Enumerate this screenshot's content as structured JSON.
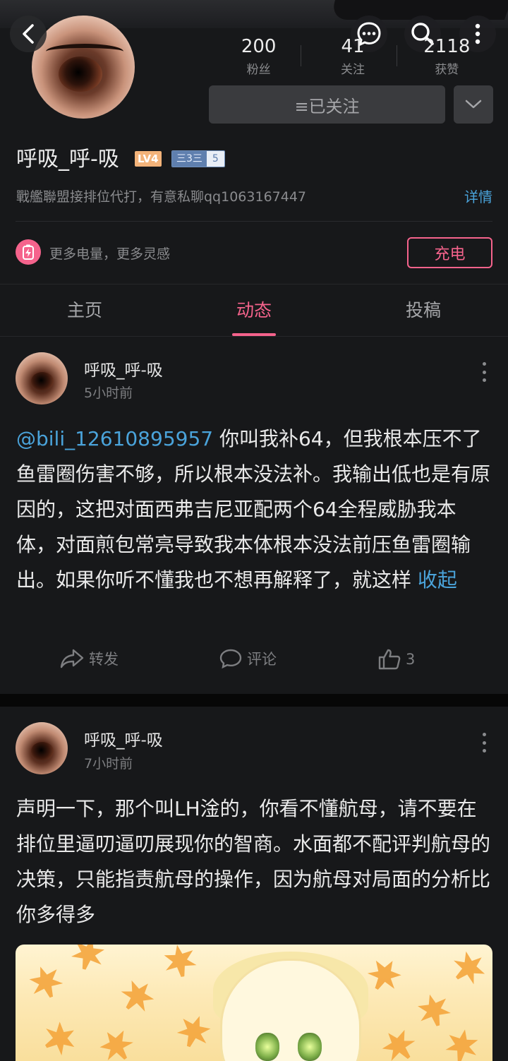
{
  "profile": {
    "stats": [
      {
        "value": "200",
        "label": "粉丝"
      },
      {
        "value": "41",
        "label": "关注"
      },
      {
        "value": "2118",
        "label": "获赞"
      }
    ],
    "follow_label": "≡已关注",
    "username": "呼吸_呼-吸",
    "level_badge": "LV4",
    "medal_name": "三3三",
    "medal_level": "5",
    "bio": "戰艦聯盟接排位代打，有意私聊qq1063167447",
    "detail_link": "详情",
    "charge_text": "更多电量，更多灵感",
    "charge_button": "充电"
  },
  "tabs": [
    {
      "label": "主页",
      "active": false
    },
    {
      "label": "动态",
      "active": true
    },
    {
      "label": "投稿",
      "active": false
    }
  ],
  "posts": [
    {
      "author": "呼吸_呼-吸",
      "time": "5小时前",
      "mention": "@bili_12610895957",
      "text": " 你叫我补64，但我根本压不了鱼雷圈伤害不够，所以根本没法补。我输出低也是有原因的，这把对面西弗吉尼亚配两个64全程威胁我本体，对面煎包常亮导致我本体根本没法前压鱼雷圈输出。如果你听不懂我也不想再解释了，就这样 ",
      "collapse": "收起",
      "repost_label": "转发",
      "comment_label": "评论",
      "like_count": "3"
    },
    {
      "author": "呼吸_呼-吸",
      "time": "7小时前",
      "text": "声明一下，那个叫LH淦的，你看不懂航母，请不要在排位里逼叨逼叨展现你的智商。水面都不配评判航母的决策，只能指责航母的操作，因为航母对局面的分析比你多得多"
    }
  ],
  "colors": {
    "accent_pink": "#f5638c",
    "link_blue": "#4aa3da",
    "background": "#17181a"
  },
  "icons": [
    "back-arrow-icon",
    "message-icon",
    "search-icon",
    "more-vertical-icon",
    "chevron-down-icon",
    "battery-charge-icon",
    "share-icon",
    "comment-icon",
    "thumbs-up-icon"
  ]
}
